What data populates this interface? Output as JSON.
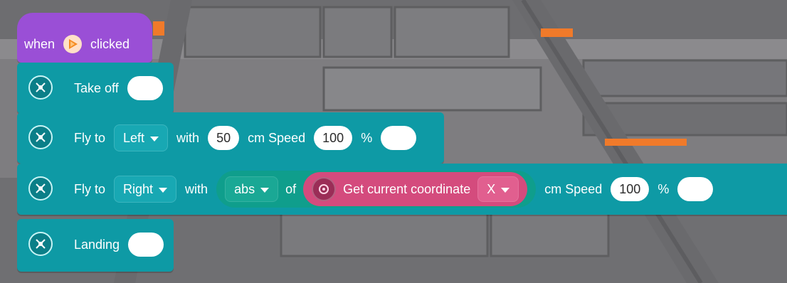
{
  "hat": {
    "word_when": "when",
    "word_clicked": "clicked",
    "flag_icon": "play-flag-icon"
  },
  "blocks": {
    "takeoff": {
      "label": "Take off"
    },
    "fly_left": {
      "fly_to": "Fly to",
      "direction": "Left",
      "with": "with",
      "distance": "50",
      "cm_speed": "cm Speed",
      "speed": "100",
      "percent": "%"
    },
    "fly_right": {
      "fly_to": "Fly to",
      "direction": "Right",
      "with": "with",
      "func": "abs",
      "of": "of",
      "get_label": "Get current coordinate",
      "axis": "X",
      "cm_speed": "cm Speed",
      "speed": "100",
      "percent": "%"
    },
    "landing": {
      "label": "Landing"
    }
  },
  "colors": {
    "hat": "#9a4fd6",
    "drone_block": "#0e9aa5",
    "reporter_green": "#0f9e8c",
    "reporter_pink": "#d44b7d"
  }
}
